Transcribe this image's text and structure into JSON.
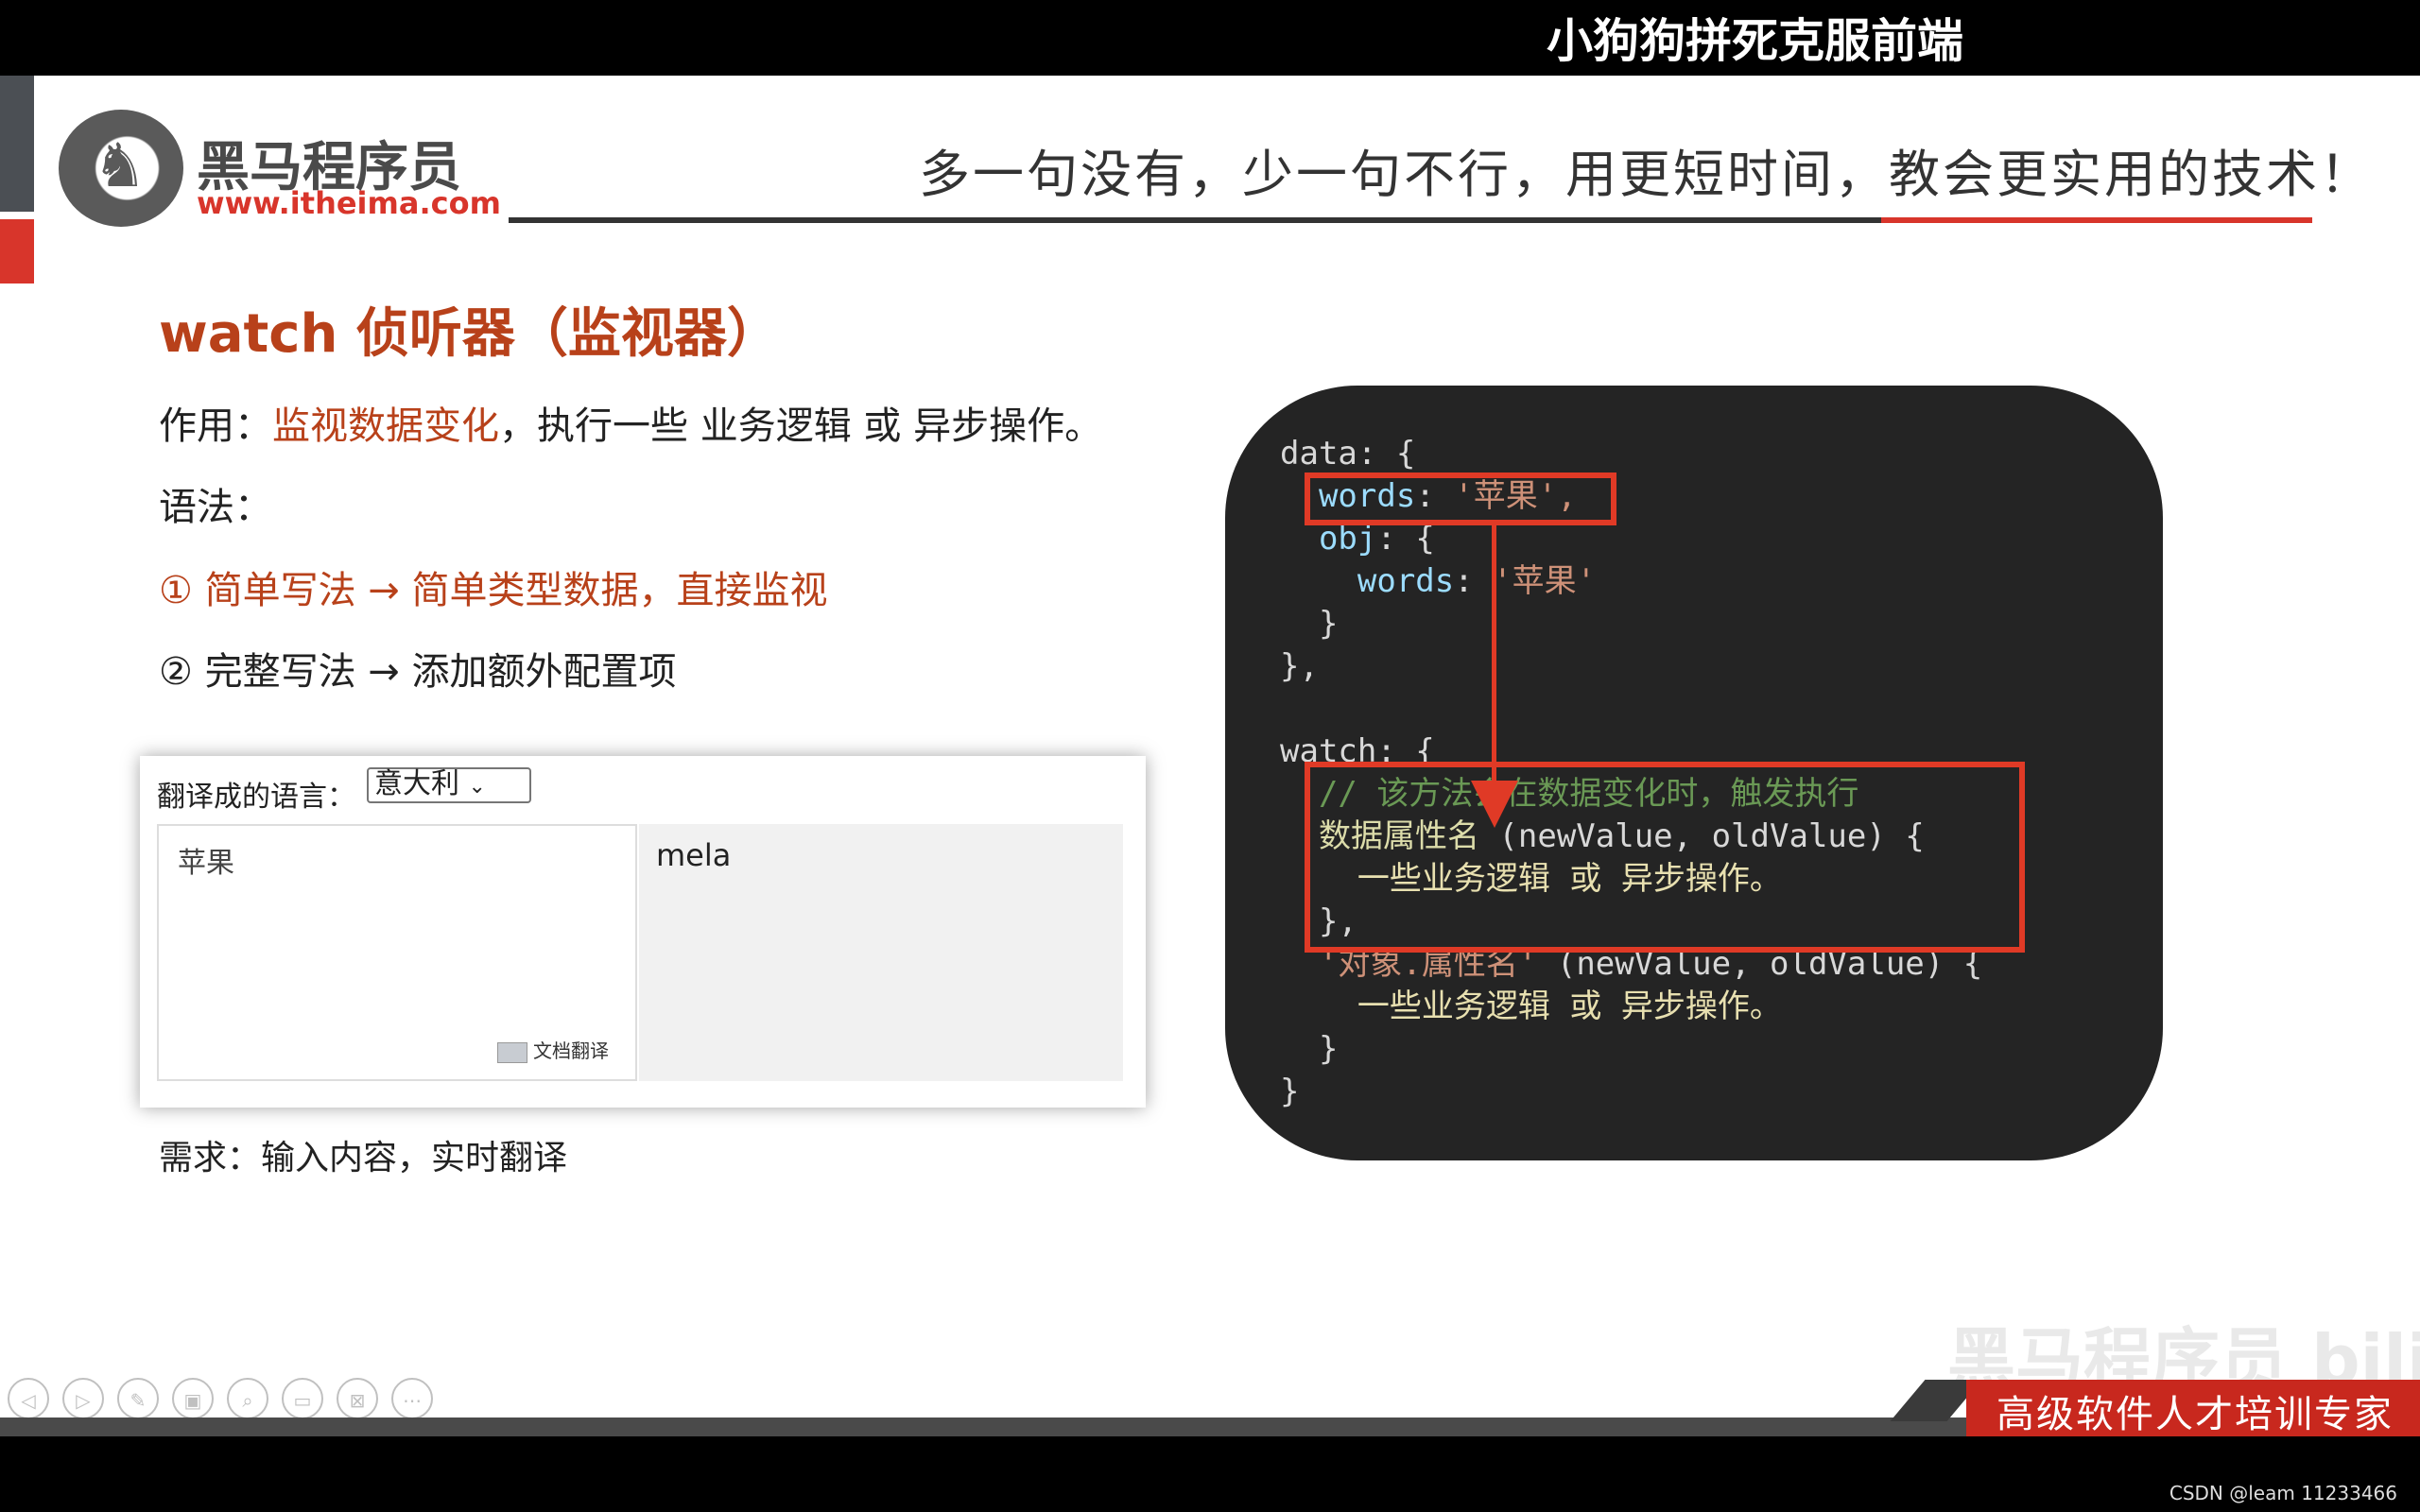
{
  "video": {
    "caption": "小狗狗拼死克服前端"
  },
  "logo": {
    "name": "黑马程序员",
    "url": "www.itheima.com"
  },
  "slogan": "多一句没有，少一句不行，用更短时间，教会更实用的技术！",
  "title": "watch 侦听器（监视器）",
  "purpose": {
    "label": "作用：",
    "highlight": "监视数据变化",
    "rest": "，执行一些 业务逻辑 或 异步操作。"
  },
  "syntax_label": "语法：",
  "methods": [
    {
      "text": "① 简单写法  →  简单类型数据，直接监视"
    },
    {
      "text": "② 完整写法  →  添加额外配置项"
    }
  ],
  "demo": {
    "lang_label": "翻译成的语言：",
    "lang_selected": "意大利",
    "source_text": "苹果",
    "doc_translate": "文档翻译",
    "output_text": "mela"
  },
  "requirement": "需求：输入内容，实时翻译",
  "code": {
    "l1": "data: {",
    "l2_key": "words",
    "l2_val": "'苹果',",
    "l3_key": "obj",
    "l3_rest": ": {",
    "l4_key": "words",
    "l4_val": "'苹果'",
    "l5": "  }",
    "l6": "},",
    "l8": "watch: {",
    "l9": "// 该方法会在数据变化时，触发执行",
    "l10_fn": "数据属性名",
    "l10_rest": " (newValue, oldValue) {",
    "l11": "一些业务逻辑 或 异步操作。",
    "l12": "},",
    "l13_fn": "'对象.属性名'",
    "l13_rest": " (newValue, oldValue) {",
    "l14": "一些业务逻辑 或 异步操作。",
    "l15": "  }",
    "l16": "}"
  },
  "footer": {
    "slogan": "高级软件人才培训专家",
    "watermark": "黑马程序员 bilibili"
  },
  "credit": "CSDN @leam 11233466",
  "colors": {
    "accent": "#d8352b",
    "title": "#b8411a",
    "code_bg": "#242424",
    "highlight_box": "#e03a26"
  }
}
